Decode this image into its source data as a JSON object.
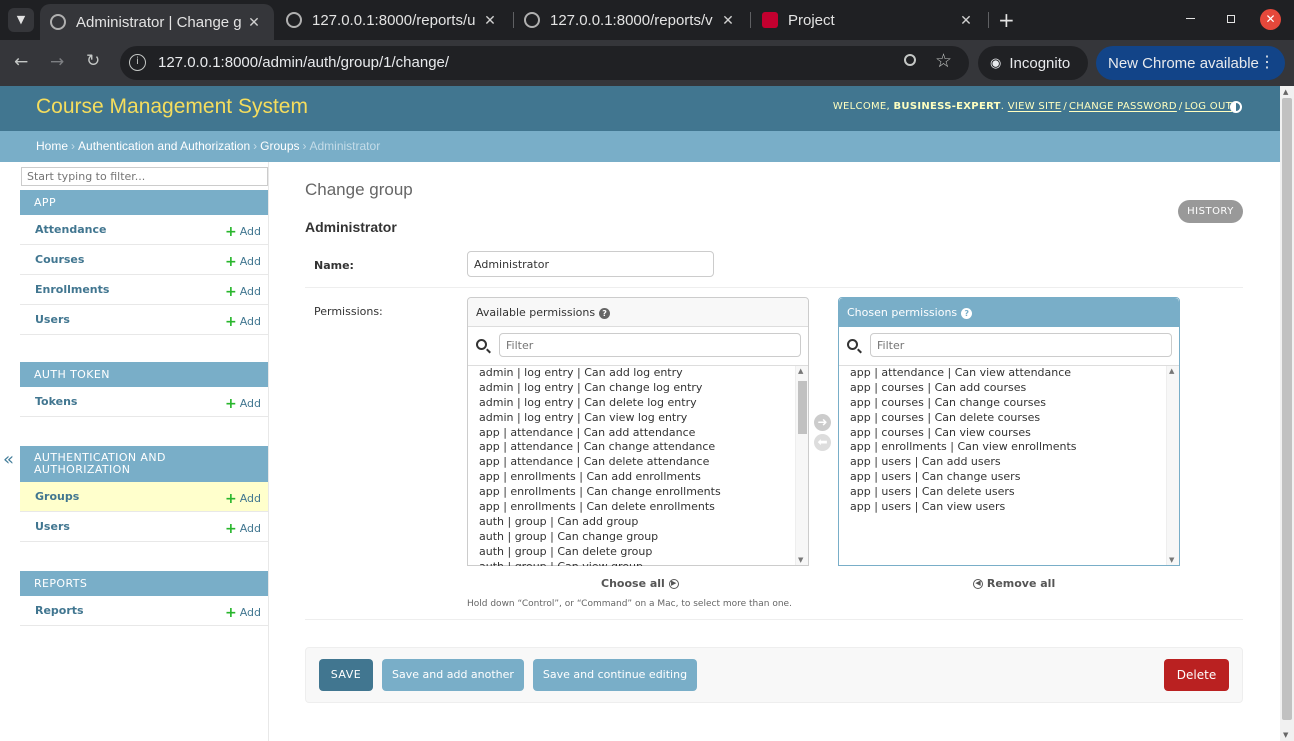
{
  "browser": {
    "tabs": [
      {
        "title": "Administrator | Change g",
        "active": true
      },
      {
        "title": "127.0.0.1:8000/reports/u",
        "active": false
      },
      {
        "title": "127.0.0.1:8000/reports/v",
        "active": false
      },
      {
        "title": "Project",
        "active": false
      }
    ],
    "new_tab": "+",
    "url": "127.0.0.1:8000/admin/auth/group/1/change/",
    "incognito": "Incognito",
    "update": "New Chrome available"
  },
  "header": {
    "brand": "Course Management System",
    "welcome": "WELCOME,",
    "user": "BUSINESS-EXPERT",
    "view_site": "VIEW SITE",
    "change_password": "CHANGE PASSWORD",
    "log_out": "LOG OUT"
  },
  "breadcrumbs": {
    "home": "Home",
    "app": "Authentication and Authorization",
    "model": "Groups",
    "current": "Administrator"
  },
  "sidebar": {
    "filter_placeholder": "Start typing to filter...",
    "collapse": "«",
    "add_label": "Add",
    "modules": [
      {
        "caption": "App",
        "items": [
          "Attendance",
          "Courses",
          "Enrollments",
          "Users"
        ]
      },
      {
        "caption": "Auth Token",
        "items": [
          "Tokens"
        ]
      },
      {
        "caption": "Authentication and Authorization",
        "items": [
          "Groups",
          "Users"
        ]
      },
      {
        "caption": "Reports",
        "items": [
          "Reports"
        ]
      }
    ]
  },
  "content": {
    "title": "Change group",
    "object_name": "Administrator",
    "history": "HISTORY",
    "name_label": "Name:",
    "name_value": "Administrator",
    "permissions_label": "Permissions:",
    "available_title": "Available permissions",
    "chosen_title": "Chosen permissions",
    "filter_placeholder": "Filter",
    "available": [
      "admin | log entry | Can add log entry",
      "admin | log entry | Can change log entry",
      "admin | log entry | Can delete log entry",
      "admin | log entry | Can view log entry",
      "app | attendance | Can add attendance",
      "app | attendance | Can change attendance",
      "app | attendance | Can delete attendance",
      "app | enrollments | Can add enrollments",
      "app | enrollments | Can change enrollments",
      "app | enrollments | Can delete enrollments",
      "auth | group | Can add group",
      "auth | group | Can change group",
      "auth | group | Can delete group",
      "auth | group | Can view group"
    ],
    "chosen": [
      "app | attendance | Can view attendance",
      "app | courses | Can add courses",
      "app | courses | Can change courses",
      "app | courses | Can delete courses",
      "app | courses | Can view courses",
      "app | enrollments | Can view enrollments",
      "app | users | Can add users",
      "app | users | Can change users",
      "app | users | Can delete users",
      "app | users | Can view users"
    ],
    "choose_all": "Choose all",
    "remove_all": "Remove all",
    "help": "Hold down “Control”, or “Command” on a Mac, to select more than one.",
    "buttons": {
      "save": "SAVE",
      "save_add": "Save and add another",
      "save_continue": "Save and continue editing",
      "delete": "Delete"
    }
  },
  "colors": {
    "header": "#417690",
    "breadcrumbs": "#79aec8",
    "brand": "#f5dd5d",
    "delete": "#ba2121",
    "add_plus": "#28b62c"
  }
}
